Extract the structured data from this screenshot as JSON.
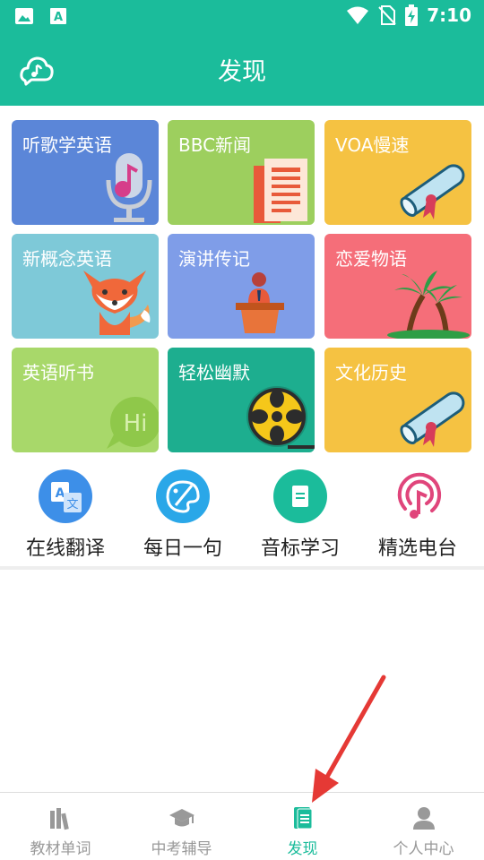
{
  "status_bar": {
    "time": "7:10",
    "icons": [
      "image-icon",
      "text-app-icon",
      "wifi-icon",
      "no-sim-icon",
      "battery-charging-icon"
    ]
  },
  "header": {
    "title": "发现",
    "logo_icon": "cloud-music-logo-icon"
  },
  "colors": {
    "brand": "#1bbc9b",
    "nav_active": "#1bbc9b",
    "nav_inactive": "#999999"
  },
  "categories": [
    {
      "label": "听歌学英语",
      "color": "#5b86d8",
      "icon": "microphone-icon"
    },
    {
      "label": "BBC新闻",
      "color": "#9dcf5e",
      "icon": "newspaper-icon"
    },
    {
      "label": "VOA慢速",
      "color": "#f5c242",
      "icon": "diploma-scroll-icon"
    },
    {
      "label": "新概念英语",
      "color": "#7ec9d8",
      "icon": "fox-icon"
    },
    {
      "label": "演讲传记",
      "color": "#7f9de8",
      "icon": "speaker-podium-icon"
    },
    {
      "label": "恋爱物语",
      "color": "#f56e79",
      "icon": "palm-island-icon"
    },
    {
      "label": "英语听书",
      "color": "#a8d86a",
      "icon": "hi-bubble-icon"
    },
    {
      "label": "轻松幽默",
      "color": "#1dae8f",
      "icon": "film-reel-icon"
    },
    {
      "label": "文化历史",
      "color": "#f5c242",
      "icon": "diploma-scroll-icon"
    }
  ],
  "quick_actions": [
    {
      "label": "在线翻译",
      "color": "#3d8fe8",
      "icon": "translate-icon"
    },
    {
      "label": "每日一句",
      "color": "#2aa7e8",
      "icon": "paint-palette-icon"
    },
    {
      "label": "音标学习",
      "color": "#1bbc9b",
      "icon": "document-icon"
    },
    {
      "label": "精选电台",
      "color": "#e0457b",
      "icon": "radio-podcast-icon"
    }
  ],
  "bottom_nav": [
    {
      "label": "教材单词",
      "icon": "books-icon",
      "active": false
    },
    {
      "label": "中考辅导",
      "icon": "graduation-cap-icon",
      "active": false
    },
    {
      "label": "发现",
      "icon": "discover-document-icon",
      "active": true
    },
    {
      "label": "个人中心",
      "icon": "person-icon",
      "active": false
    }
  ]
}
